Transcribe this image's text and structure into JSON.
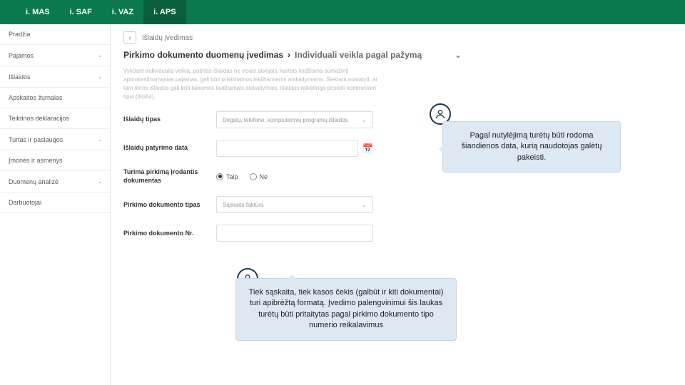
{
  "topbar": {
    "tabs": [
      "i. MAS",
      "i. SAF",
      "i. VAZ",
      "i. APS"
    ]
  },
  "sidebar": {
    "items": [
      {
        "label": "Pradžia",
        "expandable": false
      },
      {
        "label": "Pajamos",
        "expandable": true
      },
      {
        "label": "Išlaidos",
        "expandable": true
      },
      {
        "label": "Apskaitos žurnalas",
        "expandable": false
      },
      {
        "label": "Teiktinos deklaracijos",
        "expandable": false
      },
      {
        "label": "Turtas ir paslaugos",
        "expandable": true
      },
      {
        "label": "Įmonės ir asmenys",
        "expandable": false
      },
      {
        "label": "Duomenų analizė",
        "expandable": true
      },
      {
        "label": "Darbuotojai",
        "expandable": false
      }
    ]
  },
  "crumb": "Išlaidų įvedimas",
  "title": {
    "main": "Pirkimo dokumento duomenų įvedimas",
    "sub": "Individuali veikla pagal pažymą"
  },
  "desc": "Vykdant individualią veiklą, patirtas išlaidas ne visais atvejais, kartais leidžiama sumažinti apmokestinamąsias pajamas, gali būti priskiriamos leidžiamiems atskaitymams. Siekiant nustatyti, ar tam tikros išlaidos gali būti laikomos leidžiamais atskaitymais, išlaidas reikėtinga priskirti konkrečiam tipui (tikslui).",
  "form": {
    "type_label": "Išlaidų tipas",
    "type_value": "Degalų, telefono, kompiuterinių programų išlaidos",
    "date_label": "Išlaidų patyrimo data",
    "hasdoc_label": "Turima pirkimą įrodantis dokumentas",
    "hasdoc_yes": "Taip",
    "hasdoc_no": "Ne",
    "doctype_label": "Pirkimo dokumento tipas",
    "doctype_value": "Sąskaita faktūra",
    "docnum_label": "Pirkimo dokumento Nr."
  },
  "callouts": {
    "c1": "Pagal nutylėjimą turėtų būti rodoma šiandienos data, kurią naudotojas galėtų pakeisti.",
    "c2": "Tiek sąskaita, tiek kasos čekis (galbūt ir kiti dokumentai) turi apibrėžtą formatą. Įvedimo palengvinimui šis laukas turėtų būti pritaitytas pagal pirkimo dokumento tipo numerio reikalavimus"
  }
}
